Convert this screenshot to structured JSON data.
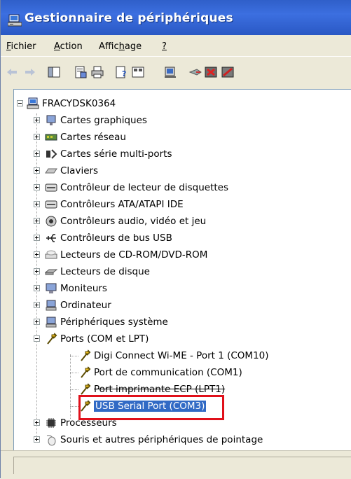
{
  "window": {
    "title": "Gestionnaire de périphériques",
    "title_icon": "device-manager-icon"
  },
  "menubar": {
    "items": [
      {
        "label": "Fichier",
        "underline": "F"
      },
      {
        "label": "Action",
        "underline": "A"
      },
      {
        "label": "Affichage",
        "underline": "h"
      },
      {
        "label": "?",
        "underline": "?"
      }
    ]
  },
  "toolbar": {
    "buttons": [
      {
        "name": "back-arrow-icon"
      },
      {
        "name": "forward-arrow-icon"
      },
      {
        "name": "console-tree-icon"
      },
      {
        "name": "properties-icon"
      },
      {
        "name": "print-icon"
      },
      {
        "name": "help-icon"
      },
      {
        "name": "view-icon"
      },
      {
        "name": "scan-hardware-icon"
      },
      {
        "name": "update-driver-icon"
      },
      {
        "name": "uninstall-icon"
      },
      {
        "name": "disable-icon"
      }
    ]
  },
  "tree": {
    "root": {
      "label": "FRACYDSK0364",
      "icon": "computer-icon"
    },
    "categories": [
      {
        "label": "Cartes graphiques",
        "icon": "display-adapter-icon"
      },
      {
        "label": "Cartes réseau",
        "icon": "network-adapter-icon"
      },
      {
        "label": "Cartes série multi-ports",
        "icon": "multiport-serial-icon"
      },
      {
        "label": "Claviers",
        "icon": "keyboard-icon"
      },
      {
        "label": "Contrôleur de lecteur de disquettes",
        "icon": "floppy-controller-icon"
      },
      {
        "label": "Contrôleurs ATA/ATAPI IDE",
        "icon": "ide-controller-icon"
      },
      {
        "label": "Contrôleurs audio, vidéo et jeu",
        "icon": "audio-icon"
      },
      {
        "label": "Contrôleurs de bus USB",
        "icon": "usb-icon"
      },
      {
        "label": "Lecteurs de CD-ROM/DVD-ROM",
        "icon": "cdrom-icon"
      },
      {
        "label": "Lecteurs de disque",
        "icon": "disk-drive-icon"
      },
      {
        "label": "Moniteurs",
        "icon": "monitor-icon"
      },
      {
        "label": "Ordinateur",
        "icon": "computer-small-icon"
      },
      {
        "label": "Périphériques système",
        "icon": "system-devices-icon"
      },
      {
        "label": "Ports (COM et LPT)",
        "icon": "port-icon",
        "expanded": true
      }
    ],
    "ports_children": [
      {
        "label": "Digi Connect Wi-ME - Port 1 (COM10)",
        "icon": "port-icon"
      },
      {
        "label": "Port de communication (COM1)",
        "icon": "port-icon"
      },
      {
        "label": "Port imprimante ECP (LPT1)",
        "icon": "port-icon"
      },
      {
        "label": "USB Serial Port (COM3)",
        "icon": "port-icon",
        "selected": true
      }
    ],
    "after_ports": [
      {
        "label": "Processeurs",
        "icon": "processor-icon"
      },
      {
        "label": "Souris et autres périphériques de pointage",
        "icon": "mouse-icon"
      }
    ]
  },
  "colors": {
    "titlebar": "#2f5fc9",
    "selection": "#316ac5",
    "highlight_box": "#e0101a",
    "chrome": "#ece9d8"
  }
}
